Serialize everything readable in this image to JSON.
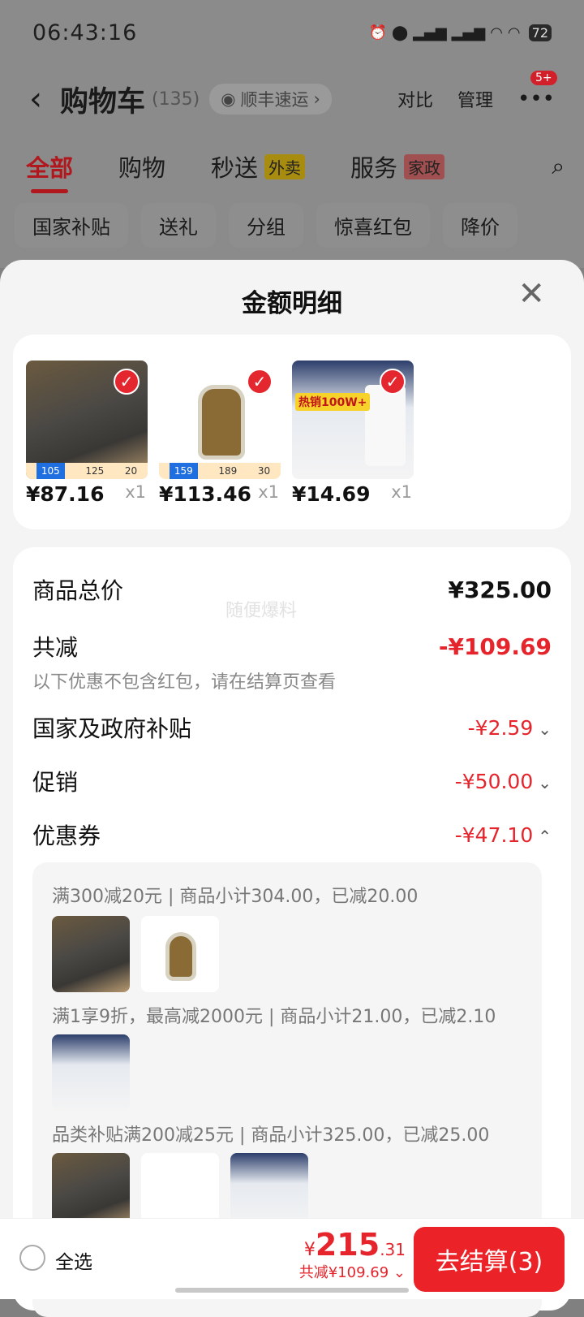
{
  "status_bar": {
    "time": "06:43:16",
    "battery": "72"
  },
  "nav": {
    "title": "购物车",
    "count": "(135)",
    "shipping_chip": "顺丰速运",
    "compare": "对比",
    "manage": "管理",
    "badge": "5+"
  },
  "tabs": [
    {
      "label": "全部"
    },
    {
      "label": "购物"
    },
    {
      "label": "秒送",
      "tag": "外卖"
    },
    {
      "label": "服务",
      "tag": "家政"
    }
  ],
  "filters": [
    "国家补贴",
    "送礼",
    "分组",
    "惊喜红包",
    "降价"
  ],
  "sheet": {
    "title": "金额明细",
    "products": [
      {
        "price": "¥87.16",
        "qty": "x1",
        "bar": [
          "105",
          "125",
          "20"
        ]
      },
      {
        "price": "¥113.46",
        "qty": "x1",
        "bar": [
          "159",
          "189",
          "30"
        ]
      },
      {
        "price": "¥14.69",
        "qty": "x1",
        "hot": "热销100W+"
      }
    ],
    "watermark": "随便爆料",
    "summary": {
      "total_label": "商品总价",
      "total_value": "¥325.00",
      "reduce_label": "共减",
      "reduce_value": "-¥109.69",
      "reduce_note": "以下优惠不包含红包，请在结算页查看",
      "subsidy_label": "国家及政府补贴",
      "subsidy_value": "-¥2.59",
      "promo_label": "促销",
      "promo_value": "-¥50.00",
      "coupon_label": "优惠券",
      "coupon_value": "-¥47.10"
    },
    "coupon_lines": [
      "满300减20元 | 商品小计304.00，已减20.00",
      "满1享9折，最高减2000元 | 商品小计21.00，已减2.10",
      "品类补贴满200减25元 | 商品小计325.00，已减25.00"
    ]
  },
  "bottom": {
    "select_all": "全选",
    "currency": "¥",
    "amount_int": "215",
    "amount_dec": ".31",
    "saved": "共减¥109.69",
    "checkout": "去结算(3)"
  },
  "colors": {
    "accent": "#e5242c"
  }
}
